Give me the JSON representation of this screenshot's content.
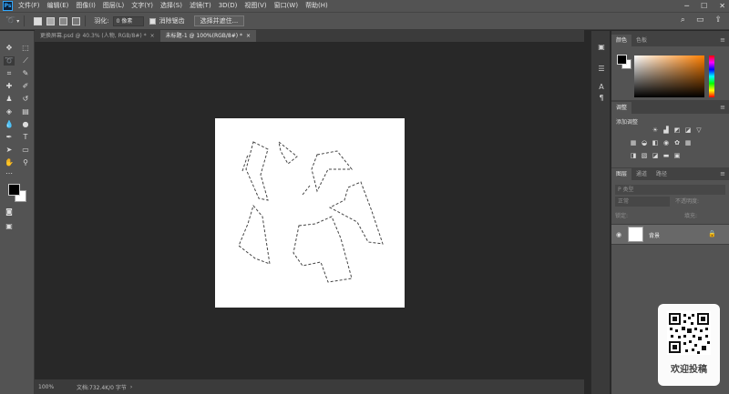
{
  "app": {
    "logo": "Ps"
  },
  "menubar": {
    "items": [
      "文件(F)",
      "编辑(E)",
      "图像(I)",
      "图层(L)",
      "文字(Y)",
      "选择(S)",
      "滤镜(T)",
      "3D(D)",
      "视图(V)",
      "窗口(W)",
      "帮助(H)"
    ],
    "window_controls": {
      "minimize": "─",
      "maximize": "☐",
      "close": "✕"
    }
  },
  "options": {
    "tool_icon": "lasso-icon",
    "feather_label": "羽化:",
    "feather_value": "0 像素",
    "antialias_label": "消除锯齿",
    "antialias_checked": true,
    "select_mask_button": "选择并遮住..."
  },
  "tabs": [
    {
      "label": "更换屏幕.psd @ 40.3% (人物, RGB/8#) *",
      "close": "×",
      "active": false
    },
    {
      "label": "未标题-1 @ 100%(RGB/8#) *",
      "close": "×",
      "active": true
    }
  ],
  "status": {
    "zoom": "100%",
    "doc_info": "文档:732.4K/0 字节",
    "arrow": "›"
  },
  "panels": {
    "color": {
      "tabs": [
        "颜色",
        "色板"
      ],
      "foreground": "#000000",
      "background": "#ffffff",
      "hue": "#ff7f00"
    },
    "adjustments": {
      "tabs": [
        "调整"
      ],
      "add_label": "添加调整"
    },
    "layers": {
      "tabs": [
        "图层",
        "通道",
        "路径"
      ],
      "kind_placeholder": "P 类型",
      "blend_mode": "正常",
      "opacity_label": "不透明度:",
      "lock_label": "锁定:",
      "fill_label": "填充:",
      "layer": {
        "name": "背景",
        "visible": true,
        "locked": true
      }
    }
  },
  "watermark": {
    "caption": "欢迎投稿"
  }
}
